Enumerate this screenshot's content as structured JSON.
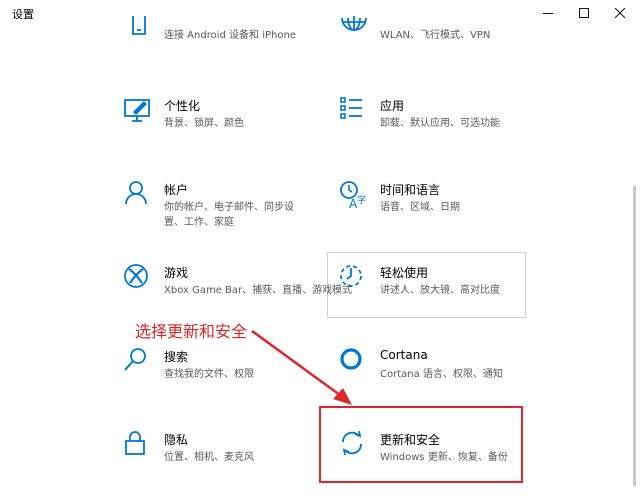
{
  "window": {
    "title": "设置"
  },
  "colors": {
    "accent": "#0078d7",
    "annotation": "#e0242a",
    "subtitle": "#5a5a5a"
  },
  "tiles": [
    {
      "title": "",
      "subtitle": "连接 Android 设备和 iPhone",
      "icon": "phone-icon"
    },
    {
      "title": "",
      "subtitle": "WLAN、飞行模式、VPN",
      "icon": "globe-icon"
    },
    {
      "title": "个性化",
      "subtitle": "背景、锁屏、颜色",
      "icon": "personalization-icon"
    },
    {
      "title": "应用",
      "subtitle": "卸载、默认应用、可选功能",
      "icon": "apps-list-icon"
    },
    {
      "title": "帐户",
      "subtitle": "你的帐户、电子邮件、同步设",
      "subtitle2": "置、工作、家庭",
      "icon": "person-icon"
    },
    {
      "title": "时间和语言",
      "subtitle": "语音、区域、日期",
      "icon": "time-language-icon"
    },
    {
      "title": "游戏",
      "subtitle": "Xbox Game Bar、捕获、直播、游戏模式",
      "icon": "xbox-icon"
    },
    {
      "title": "轻松使用",
      "subtitle": "讲述人、放大镜、高对比度",
      "icon": "ease-of-access-icon"
    },
    {
      "title": "搜索",
      "subtitle": "查找我的文件、权限",
      "icon": "search-icon"
    },
    {
      "title": "Cortana",
      "subtitle": "Cortana 语言、权限、通知",
      "icon": "cortana-icon"
    },
    {
      "title": "隐私",
      "subtitle": "位置、相机、麦克风",
      "icon": "lock-icon"
    },
    {
      "title": "更新和安全",
      "subtitle": "Windows 更新、恢复、备份",
      "icon": "update-sync-icon"
    }
  ],
  "annotation": {
    "label": "选择更新和安全"
  }
}
